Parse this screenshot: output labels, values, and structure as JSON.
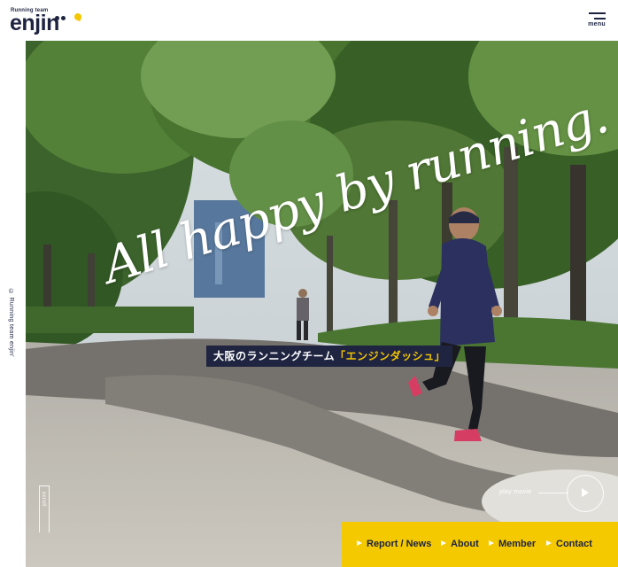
{
  "brand": {
    "small_text": "Running team",
    "name": "enjin",
    "accent": "#f4c700",
    "navy": "#1d2340"
  },
  "header": {
    "menu_label": "menu",
    "menu_icon": "hamburger-icon"
  },
  "side": {
    "copyright": "© Running team enjin'"
  },
  "hero": {
    "tagline": "All happy by running.",
    "subtitle_pre": "大阪のランニングチーム",
    "subtitle_highlight": "「エンジンダッシュ」",
    "scroll_label": "scroll",
    "play_label": "play movie",
    "play_icon": "play-icon"
  },
  "nav": {
    "items": [
      {
        "label": "Report / News"
      },
      {
        "label": "About"
      },
      {
        "label": "Member"
      },
      {
        "label": "Contact"
      }
    ],
    "background": "#f5c900"
  }
}
